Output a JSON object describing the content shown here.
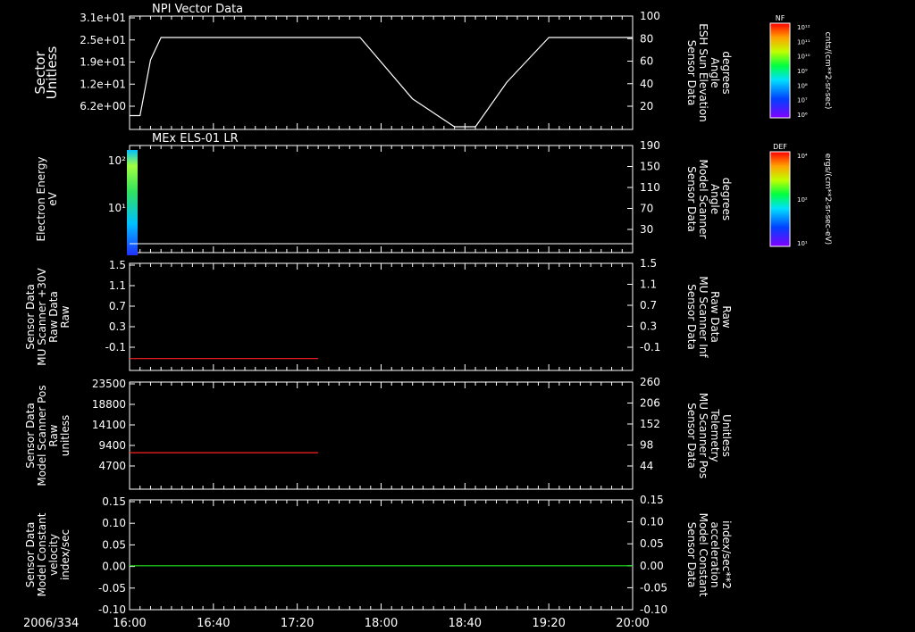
{
  "date_label": "2006/334",
  "time_ticks": [
    "16:00",
    "16:40",
    "17:20",
    "18:00",
    "18:40",
    "19:20",
    "20:00"
  ],
  "panels": [
    {
      "title": "NPI Vector Data",
      "left_label": [
        "Sector",
        "Unitless"
      ],
      "left_ticks": [
        "3.1e+01",
        "2.5e+01",
        "1.9e+01",
        "1.2e+01",
        "6.2e+00"
      ],
      "right_label": [
        "Sensor Data",
        "ESH Sun Elevation",
        "Angle",
        "degrees"
      ],
      "right_ticks": [
        "100",
        "80",
        "60",
        "40",
        "20"
      ],
      "color": "#ffffff"
    },
    {
      "title": "MEx ELS-01 LR",
      "left_label": [
        "Electron Energy",
        "eV"
      ],
      "left_ticks": [
        "10²",
        "10¹"
      ],
      "right_label": [
        "Sensor Data",
        "Model Scanner",
        "Angle",
        "degrees"
      ],
      "right_ticks": [
        "190",
        "150",
        "110",
        "70",
        "30"
      ],
      "color": "#ffffff"
    },
    {
      "title": "",
      "left_label": [
        "Sensor Data",
        "MU Scanner +30V",
        "Raw Data",
        "Raw"
      ],
      "left_ticks": [
        "1.5",
        "1.1",
        "0.7",
        "0.3",
        "-0.1"
      ],
      "right_label": [
        "Sensor Data",
        "MU Scanner Inf",
        "Raw Data",
        "Raw"
      ],
      "right_ticks": [
        "1.5",
        "1.1",
        "0.7",
        "0.3",
        "-0.1"
      ],
      "color": "#ff2020"
    },
    {
      "title": "",
      "left_label": [
        "Sensor Data",
        "Model Scanner Pos",
        "Raw",
        "unitless"
      ],
      "left_ticks": [
        "23500",
        "18800",
        "14100",
        "9400",
        "4700"
      ],
      "right_label": [
        "Sensor Data",
        "MU Scanner Pos",
        "Telemetry",
        "Unitless"
      ],
      "right_ticks": [
        "260",
        "206",
        "152",
        "98",
        "44"
      ],
      "color": "#ff2020"
    },
    {
      "title": "",
      "left_label": [
        "Sensor Data",
        "Model Constant",
        "velocity",
        "index/sec"
      ],
      "left_ticks": [
        "0.15",
        "0.10",
        "0.05",
        "0.00",
        "-0.05",
        "-0.10"
      ],
      "right_label": [
        "Sensor Data",
        "Model Constant",
        "acceleration",
        "index/sec**2"
      ],
      "right_ticks": [
        "0.15",
        "0.10",
        "0.05",
        "0.00",
        "-0.05",
        "-0.10"
      ],
      "color": "#20e020"
    }
  ],
  "colorbars": [
    {
      "label": "NF",
      "unit": "cnts/(cm**2-sr-sec)",
      "ticks": [
        "10¹²",
        "10¹¹",
        "10¹⁰",
        "10⁹",
        "10⁸",
        "10⁷",
        "10⁶"
      ]
    },
    {
      "label": "DEF",
      "unit": "ergs/(cm**2-sr-sec-eV)",
      "ticks": [
        "10⁴",
        "10²",
        "10¹"
      ]
    }
  ],
  "chart_data": [
    {
      "type": "line",
      "title": "NPI Vector Data",
      "x_range": [
        "16:00",
        "20:00"
      ],
      "ylim_right": [
        0,
        100
      ],
      "series": [
        {
          "x": [
            "16:00",
            "16:05",
            "16:10",
            "16:15",
            "17:50",
            "18:15",
            "18:35",
            "18:45",
            "19:00",
            "19:20",
            "20:00"
          ],
          "values": [
            10,
            10,
            60,
            80,
            80,
            25,
            0,
            0,
            40,
            80,
            80
          ]
        }
      ]
    },
    {
      "type": "heatmap",
      "title": "MEx ELS-01 LR",
      "x_range": [
        "16:00",
        "16:02"
      ],
      "y_range_eV": [
        2,
        200
      ]
    },
    {
      "type": "line",
      "x_range": [
        "16:00",
        "17:30"
      ],
      "ylim": [
        -0.3,
        1.5
      ],
      "series": [
        {
          "x": [
            "16:00",
            "17:30"
          ],
          "values": [
            -0.1,
            -0.1
          ]
        }
      ]
    },
    {
      "type": "line",
      "x_range": [
        "16:00",
        "17:30"
      ],
      "ylim": [
        0,
        23500
      ],
      "series": [
        {
          "x": [
            "16:00",
            "17:30"
          ],
          "values": [
            8000,
            8000
          ]
        }
      ]
    },
    {
      "type": "line",
      "x_range": [
        "16:00",
        "20:00"
      ],
      "ylim": [
        -0.1,
        0.15
      ],
      "series": [
        {
          "x": [
            "16:00",
            "20:00"
          ],
          "values": [
            0.0,
            0.0
          ]
        }
      ]
    }
  ]
}
